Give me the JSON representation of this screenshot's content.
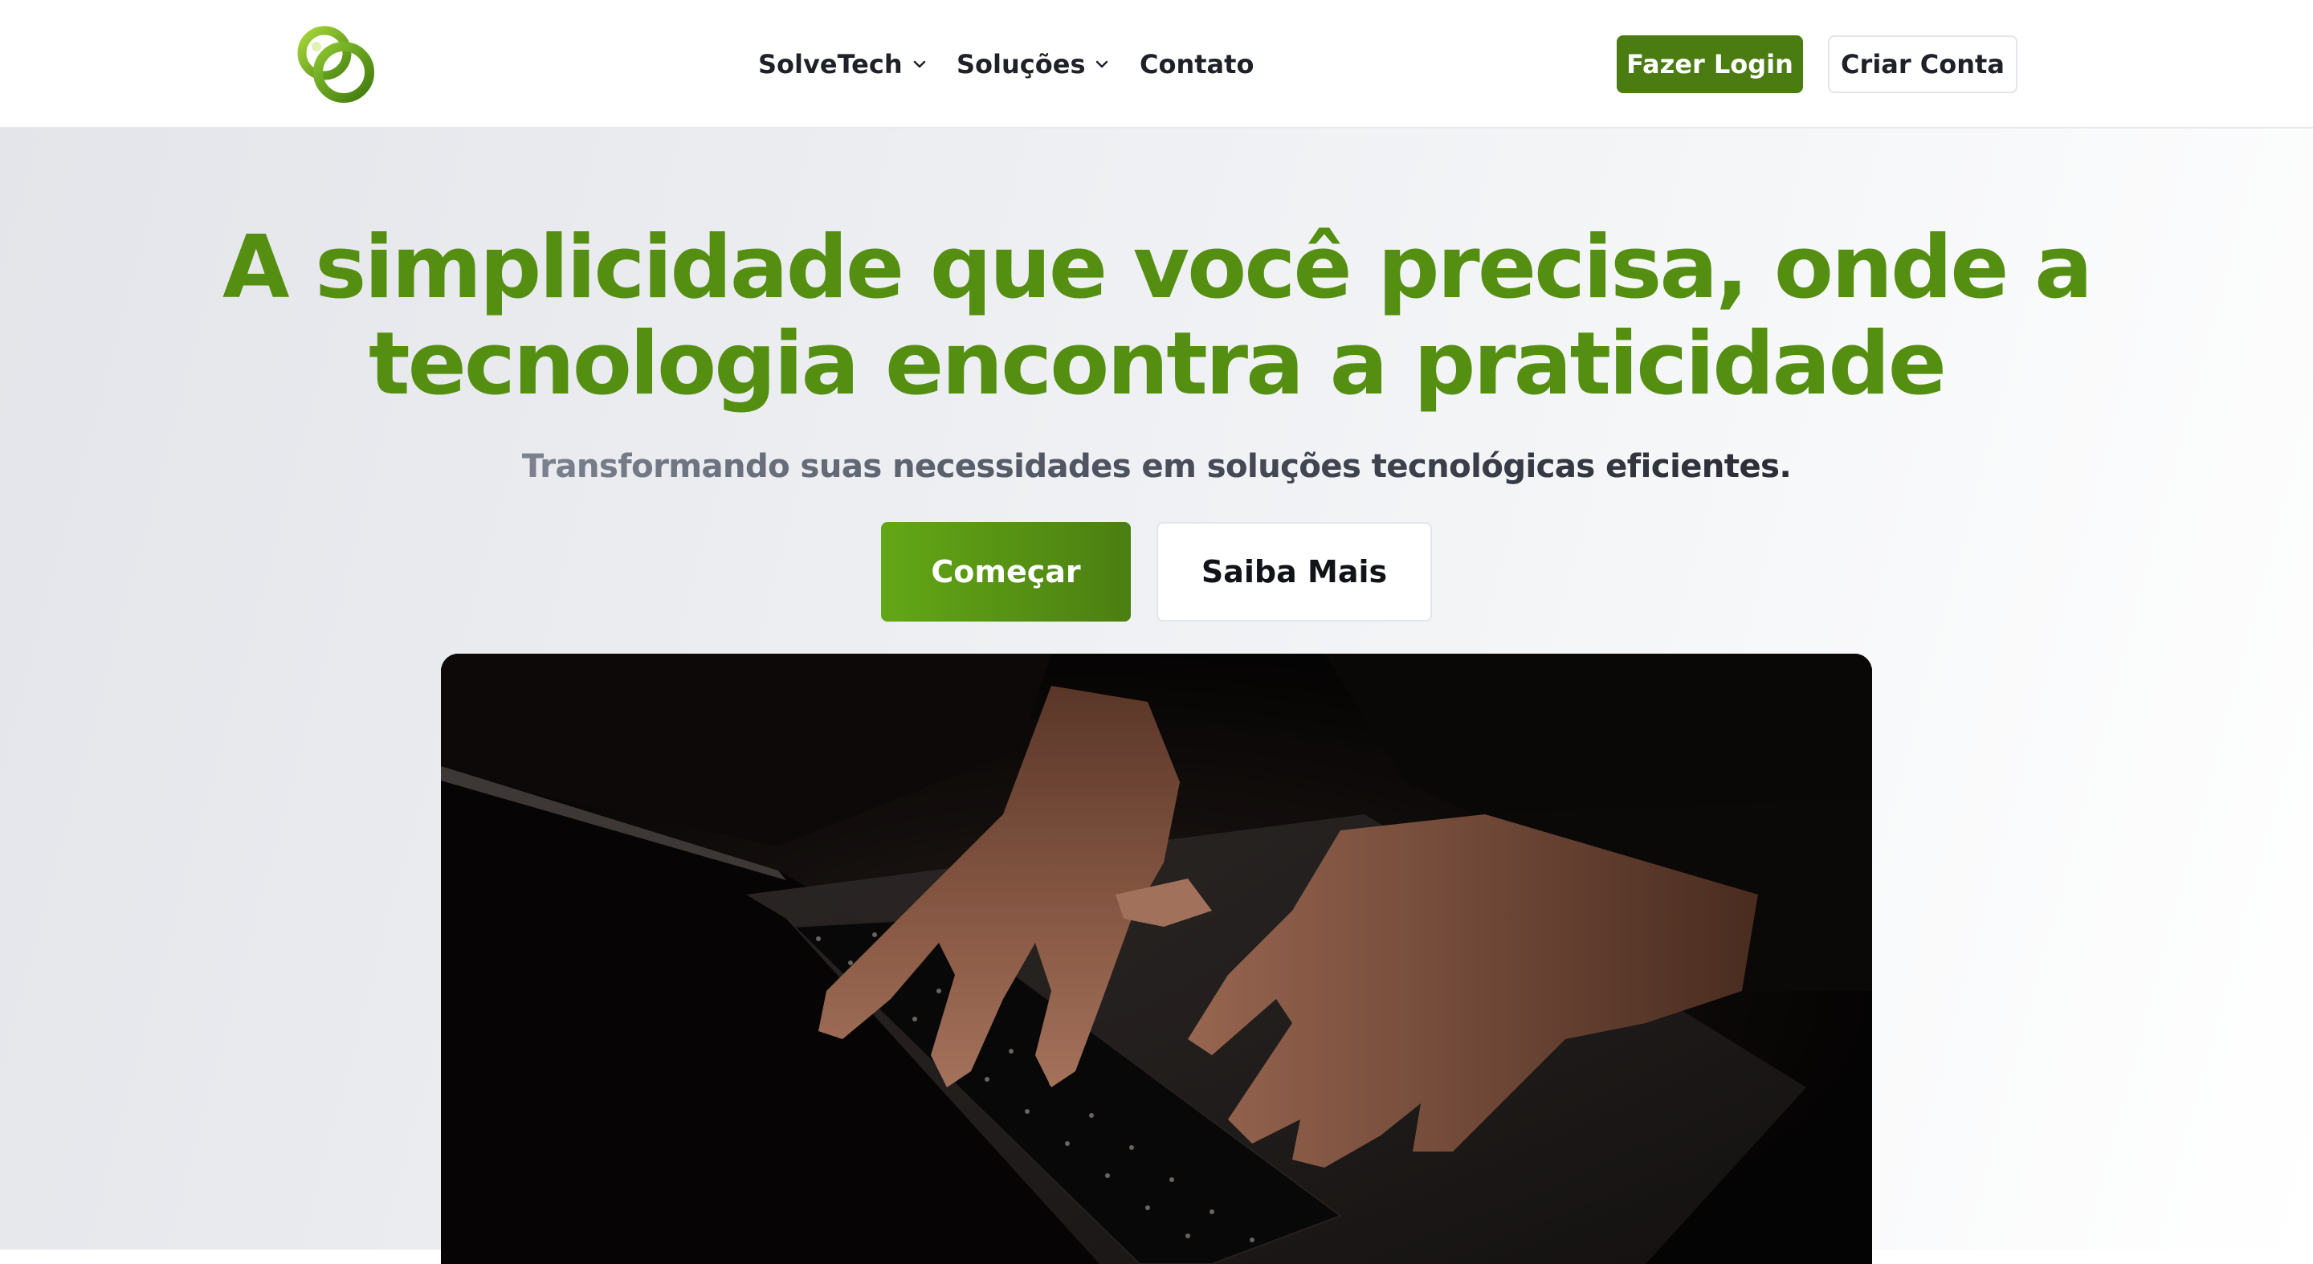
{
  "header": {
    "logo_name": "solvetech-logo",
    "nav": [
      {
        "label": "SolveTech",
        "has_dropdown": true
      },
      {
        "label": "Soluções",
        "has_dropdown": true
      },
      {
        "label": "Contato",
        "has_dropdown": false
      }
    ],
    "login_label": "Fazer Login",
    "signup_label": "Criar Conta"
  },
  "hero": {
    "title_line1": "A simplicidade que você precisa, onde a",
    "title_line2": "tecnologia encontra a praticidade",
    "subtitle": "Transformando suas necessidades em soluções tecnológicas eficientes.",
    "primary_cta": "Começar",
    "secondary_cta": "Saiba Mais",
    "media": "hands typing on laptop keyboard in dark room"
  },
  "colors": {
    "brand_green": "#558f11",
    "brand_green_dark": "#4a7c12",
    "brand_green_light": "#63a716",
    "text_dark": "#1f2128"
  }
}
